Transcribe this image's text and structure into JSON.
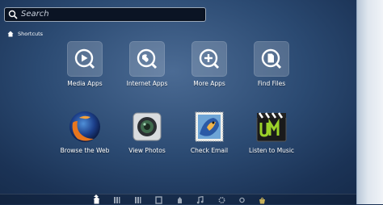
{
  "search": {
    "placeholder": "Search"
  },
  "breadcrumb": {
    "label": "Shortcuts"
  },
  "categories": [
    {
      "label": "Media Apps",
      "icon": "media-apps-icon"
    },
    {
      "label": "Internet Apps",
      "icon": "internet-apps-icon"
    },
    {
      "label": "More Apps",
      "icon": "more-apps-icon"
    },
    {
      "label": "Find Files",
      "icon": "find-files-icon"
    }
  ],
  "apps": [
    {
      "label": "Browse the Web",
      "icon": "firefox-icon"
    },
    {
      "label": "View Photos",
      "icon": "camera-icon"
    },
    {
      "label": "Check Email",
      "icon": "thunderbird-icon"
    },
    {
      "label": "Listen to Music",
      "icon": "music-player-icon"
    }
  ],
  "dock": [
    "home-lens-icon",
    "applications-lens-icon",
    "files-lens-icon",
    "folders-lens-icon",
    "photos-lens-icon",
    "music-lens-icon",
    "settings-lens-icon",
    "social-lens-icon",
    "shopping-lens-icon"
  ],
  "colors": {
    "accent": "#2b4a72",
    "tile": "#ffffff2e"
  }
}
